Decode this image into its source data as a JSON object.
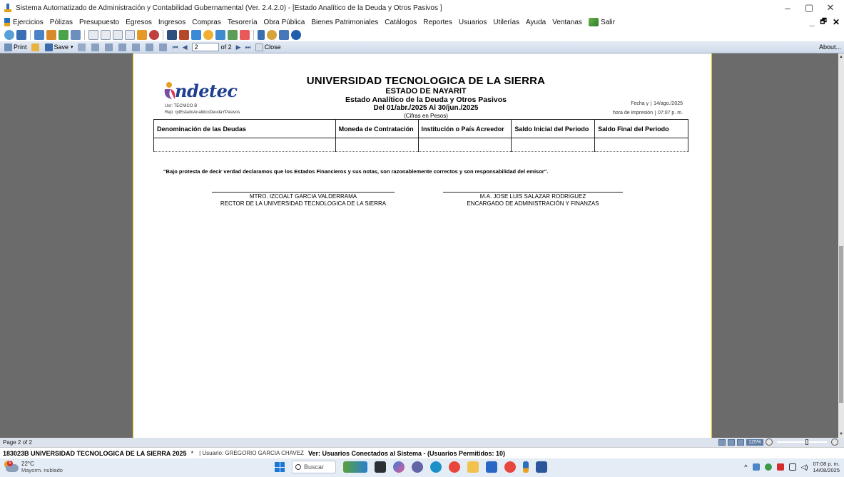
{
  "window": {
    "title": "Sistema Automatizado de Administración y Contabilidad Gubernamental  (Ver. 2.4.2.0) - [Estado Analítico de la Deuda y Otros Pasivos ]",
    "minimize": "–",
    "maximize": "▢",
    "close": "✕"
  },
  "menu": {
    "items": [
      "Ejercicios",
      "Pólizas",
      "Presupuesto",
      "Egresos",
      "Ingresos",
      "Compras",
      "Tesorería",
      "Obra Pública",
      "Bienes Patrimoniales",
      "Catálogos",
      "Reportes",
      "Usuarios",
      "Utilerías",
      "Ayuda",
      "Ventanas"
    ],
    "salir": "Salir",
    "mdi_min": "_",
    "mdi_restore": "🗗",
    "mdi_close": "✕"
  },
  "toolbar_icons": [
    "refresh-icon",
    "report-icon",
    "users-icon",
    "transfer-icon",
    "chart-icon",
    "doc-icon",
    "form-icon",
    "form2-icon",
    "form3-icon",
    "record-icon",
    "star-icon",
    "book-icon",
    "cash-icon",
    "coins-icon",
    "pie-icon",
    "search-doc-icon",
    "tools-icon",
    "settings-icon",
    "tree-icon",
    "search-icon",
    "table-icon",
    "help-icon"
  ],
  "report_viewer": {
    "print_label": "Print",
    "save_label": "Save",
    "page_input": "2",
    "page_of": "of 2",
    "close_label": "Close",
    "about_label": "About..."
  },
  "report": {
    "logo_text": "ndetec",
    "user_line": "Usr: TECNICO B",
    "rep_line": "Rep: rptEstadoAnaliticoDeudaYPasivos",
    "title": "UNIVERSIDAD TECNOLOGICA DE LA SIERRA",
    "state": "ESTADO DE NAYARIT",
    "subtitle": "Estado Analítico de la Deuda y Otros Pasivos",
    "period": "Del 01/abr./2025 Al 30/jun./2025",
    "units": "(Cifras en Pesos)",
    "fecha_label": "Fecha y",
    "fecha_value": "14/ago./2025",
    "hora_label": "hora de impresión",
    "hora_value": "07:07 p. m.",
    "columns": [
      "Denominación de las Deudas",
      "Moneda de Contratación",
      "Institución o País Acreedor",
      "Saldo Inicial del Periodo",
      "Saldo Final del Periodo"
    ],
    "declaration": "\"Bajo protesta de decir verdad declaramos que los Estados Financieros y sus notas, son razonablemente correctos y son responsabilidad del emisor\".",
    "signers": [
      {
        "name": "MTRO. IZCOALT GARCIA VALDERRAMA",
        "role": "RECTOR DE LA UNIVERSIDAD TECNOLOGICA DE LA SIERRA"
      },
      {
        "name": "M.A. JOSE LUIS SALAZAR RODRIGUEZ",
        "role": "ENCARGADO DE ADMINISTRACIÓN Y FINANZAS"
      }
    ]
  },
  "viewer_status": {
    "page": "Page 2 of 2",
    "zoom": "125%"
  },
  "app_status": {
    "entity": "183023B UNIVERSIDAD TECNOLOGICA DE LA SIERRA  2025",
    "marker": "*",
    "user": "| Usuario: GREGORIO GARCIA CHAVEZ",
    "connected": "Ver: Usuarios Conectados al Sistema - (Usuarios Permitidos: 10)"
  },
  "taskbar": {
    "weather_badge": "5",
    "temperature": "22°C",
    "condition": "Mayorm. nublado",
    "search_placeholder": "Buscar",
    "time": "07:08 p. m.",
    "date": "14/08/2025"
  }
}
